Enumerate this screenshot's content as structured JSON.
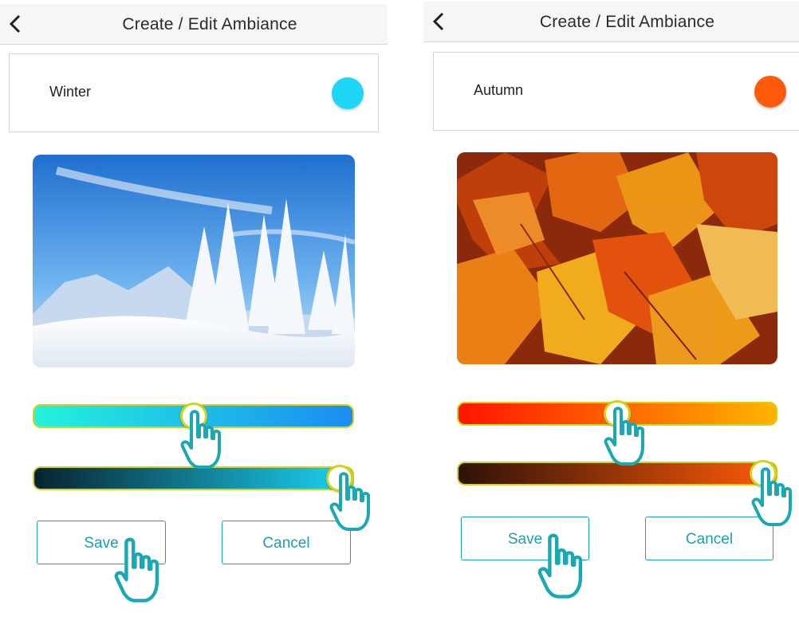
{
  "screens": [
    {
      "header": {
        "title": "Create / Edit Ambiance",
        "back_icon": "chevron-left-icon"
      },
      "ambiance_name": "Winter",
      "color_swatch": "#1ed6f5",
      "image": "winter-snowy-trees-photo",
      "slider_hue": {
        "gradient": [
          "#24f2dc",
          "#1a8cf2"
        ],
        "value": 0.5
      },
      "slider_brightness": {
        "gradient": [
          "#08232f",
          "#1cd4f4"
        ],
        "value": 0.96
      },
      "save_label": "Save",
      "cancel_label": "Cancel"
    },
    {
      "header": {
        "title": "Create / Edit Ambiance",
        "back_icon": "chevron-left-icon"
      },
      "ambiance_name": "Autumn",
      "color_swatch": "#ff5a09",
      "image": "autumn-maple-leaves-photo",
      "slider_hue": {
        "gradient": [
          "#ff1400",
          "#ffb400"
        ],
        "value": 0.5
      },
      "slider_brightness": {
        "gradient": [
          "#2e1106",
          "#ff5a09"
        ],
        "value": 0.96
      },
      "save_label": "Save",
      "cancel_label": "Cancel"
    }
  ],
  "colors": {
    "accent": "#1a9fb0",
    "slider_border": "#cfd41a",
    "header_bg": "#f6f6f6"
  }
}
